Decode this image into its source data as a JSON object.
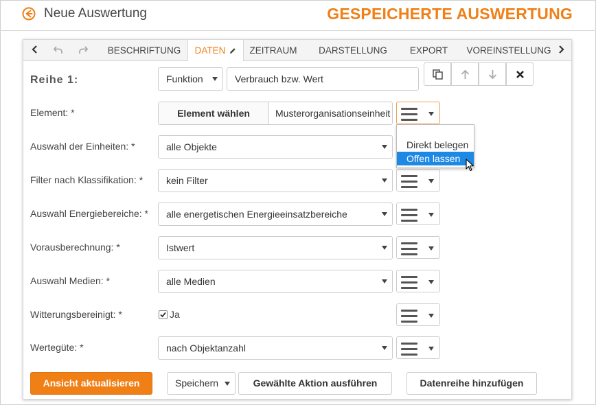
{
  "header": {
    "back_label": "Neue Auswertung",
    "title": "GESPEICHERTE AUSWERTUNG"
  },
  "tabs": [
    {
      "label": "BESCHRIFTUNG"
    },
    {
      "label": "DATEN"
    },
    {
      "label": "ZEITRAUM"
    },
    {
      "label": "DARSTELLUNG"
    },
    {
      "label": "EXPORT"
    },
    {
      "label": "VOREINSTELLUNG"
    }
  ],
  "row": {
    "title": "Reihe 1:",
    "funktion": "Funktion",
    "funktion_value": "Verbrauch bzw. Wert"
  },
  "fields": {
    "element_label": "Element: *",
    "element_button": "Element wählen",
    "element_value": "Musterorganisationseinheit",
    "einheiten_label": "Auswahl der Einheiten: *",
    "einheiten_value": "alle Objekte",
    "filter_label": "Filter nach Klassifikation: *",
    "filter_value": "kein Filter",
    "energie_label": "Auswahl Energiebereiche: *",
    "energie_value": "alle energetischen Energieeinsatzbereiche",
    "voraus_label": "Vorausberechnung: *",
    "voraus_value": "Istwert",
    "medien_label": "Auswahl Medien: *",
    "medien_value": "alle Medien",
    "witterung_label": "Witterungsbereinigt: *",
    "witterung_value": "Ja",
    "wertegute_label": "Wertegüte: *",
    "wertegute_value": "nach Objektanzahl"
  },
  "dropdown": {
    "items": [
      "Direkt belegen",
      "Offen lassen"
    ],
    "highlighted": "Offen lassen"
  },
  "footer": {
    "update": "Ansicht aktualisieren",
    "save": "Speichern",
    "execute": "Gewählte Aktion ausführen",
    "add_series": "Datenreihe hinzufügen"
  },
  "colors": {
    "accent": "#f07f16",
    "highlight": "#1e88e5"
  }
}
